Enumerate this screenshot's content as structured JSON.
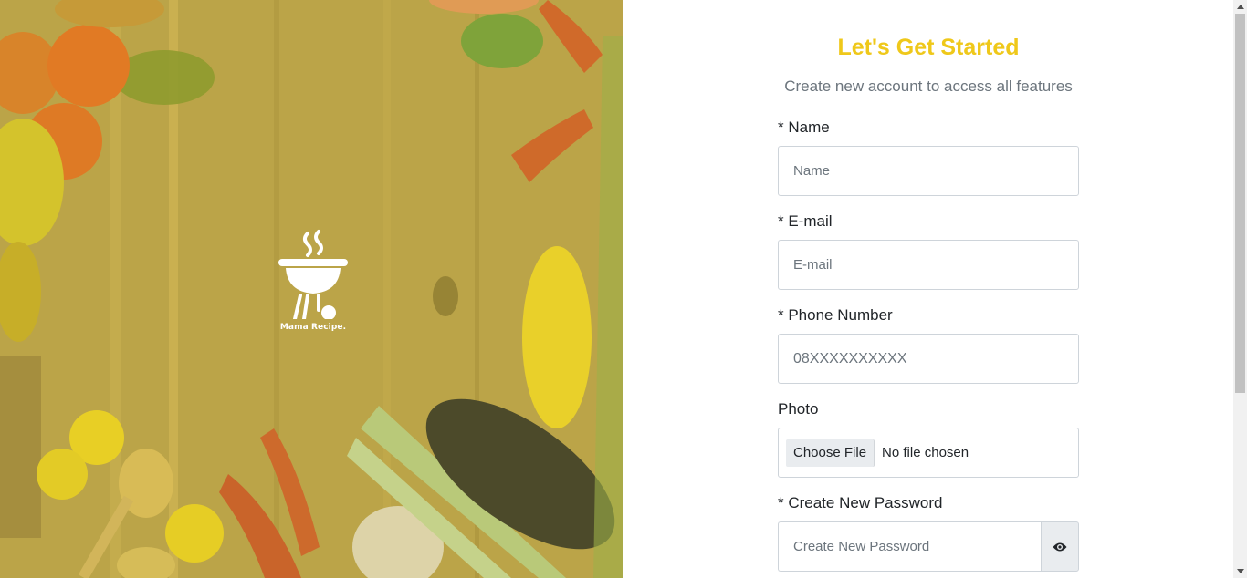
{
  "brand": {
    "name": "Mama Recipe.",
    "logo_icon": "grill-icon",
    "accent_color": "#efc81a"
  },
  "form": {
    "title": "Let's Get Started",
    "subtitle": "Create new account to access all features",
    "name": {
      "label": "* Name",
      "placeholder": "Name",
      "value": ""
    },
    "email": {
      "label": "* E-mail",
      "placeholder": "E-mail",
      "value": ""
    },
    "phone": {
      "label": "* Phone Number",
      "placeholder": "08XXXXXXXXXX",
      "value": ""
    },
    "photo": {
      "label": "Photo",
      "button_label": "Choose File",
      "status": "No file chosen"
    },
    "password": {
      "label": "* Create New Password",
      "placeholder": "Create New Password",
      "toggle_icon": "eye-icon"
    }
  }
}
